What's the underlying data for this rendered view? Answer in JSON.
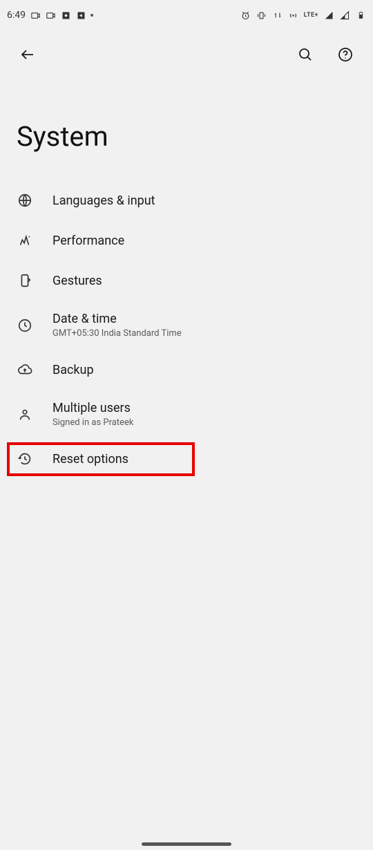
{
  "status": {
    "time": "6:49",
    "lte_label": "LTE+"
  },
  "appbar": {},
  "page": {
    "title": "System"
  },
  "settings": {
    "languages": {
      "title": "Languages & input"
    },
    "performance": {
      "title": "Performance"
    },
    "gestures": {
      "title": "Gestures"
    },
    "datetime": {
      "title": "Date & time",
      "subtitle": "GMT+05:30 India Standard Time"
    },
    "backup": {
      "title": "Backup"
    },
    "multiple_users": {
      "title": "Multiple users",
      "subtitle": "Signed in as Prateek"
    },
    "reset": {
      "title": "Reset options"
    }
  }
}
